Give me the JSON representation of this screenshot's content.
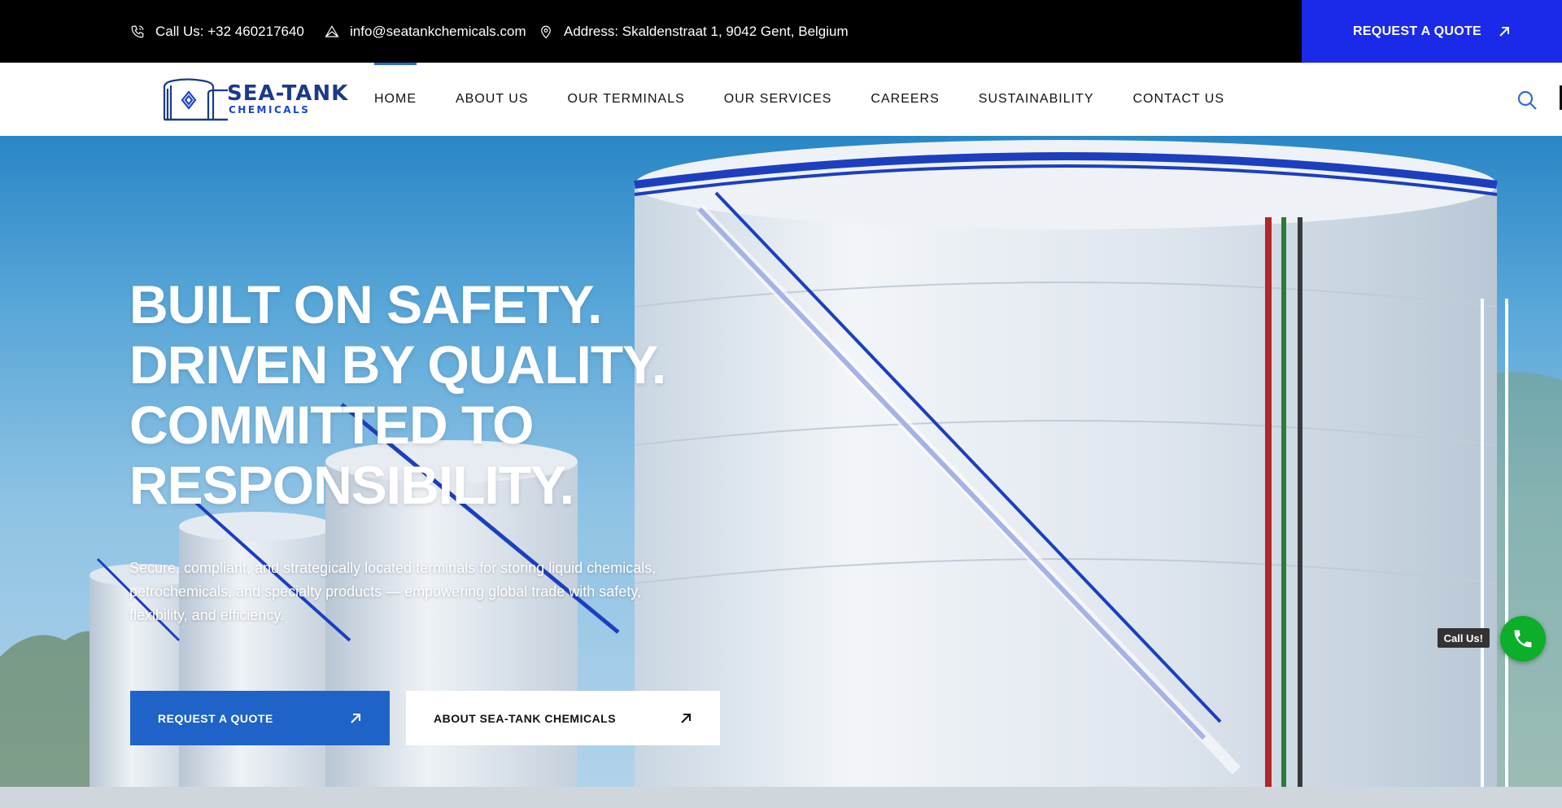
{
  "topbar": {
    "phone": "Call Us: +32 460217640",
    "email": "info@seatankchemicals.com",
    "address": "Address: Skaldenstraat 1, 9042 Gent, Belgium",
    "quote_button": "REQUEST A QUOTE"
  },
  "logo": {
    "line1": "SEA-TANK",
    "line2": "CHEMICALS"
  },
  "nav": {
    "items": [
      "HOME",
      "ABOUT US",
      "OUR TERMINALS",
      "OUR SERVICES",
      "CAREERS",
      "SUSTAINABILITY",
      "CONTACT US"
    ],
    "active": "HOME"
  },
  "hero": {
    "title": "BUILT ON SAFETY. DRIVEN BY QUALITY. COMMITTED TO RESPONSIBILITY.",
    "subtitle": "Secure, compliant, and strategically located terminals for storing liquid chemicals, petrochemicals, and specialty products — empowering global trade with safety, flexibility, and efficiency.",
    "primary_button": "REQUEST A QUOTE",
    "secondary_button": "ABOUT SEA-TANK CHEMICALS"
  },
  "floating": {
    "call_label": "Call Us!"
  },
  "colors": {
    "topbar_bg": "#000000",
    "quote_bg": "#1a2ae8",
    "primary_button": "#1f63c8",
    "call_fab": "#0cae2a",
    "nav_active_indicator": "#2e6ad8"
  },
  "icons": {
    "phone": "phone-icon",
    "email": "mail-icon",
    "address": "map-pin-icon",
    "arrow": "arrow-up-right-icon",
    "search": "search-icon",
    "call": "phone-handset-icon"
  }
}
